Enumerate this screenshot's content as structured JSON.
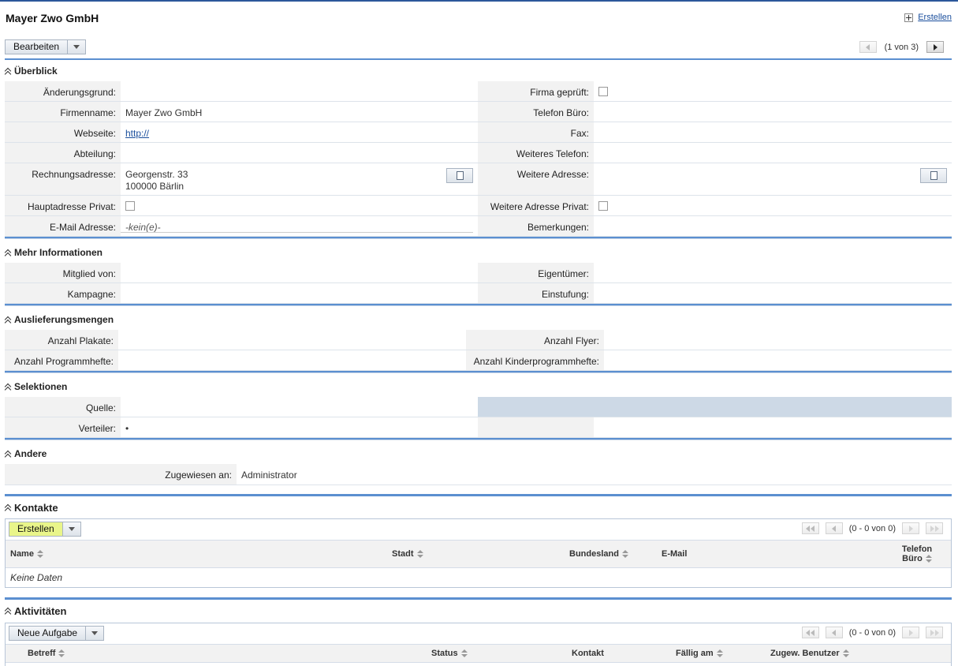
{
  "page": {
    "title": "Mayer Zwo GmbH",
    "create_link": "Erstellen"
  },
  "toolbar": {
    "edit_label": "Bearbeiten",
    "pager_text": "(1 von 3)"
  },
  "overview": {
    "title": "Überblick",
    "rows": [
      {
        "l1": "Änderungsgrund:",
        "v1": "",
        "l2": "Firma geprüft:",
        "v2": ""
      },
      {
        "l1": "Firmenname:",
        "v1": "Mayer Zwo GmbH",
        "l2": "Telefon Büro:",
        "v2": ""
      },
      {
        "l1": "Webseite:",
        "v1": "http://",
        "l2": "Fax:",
        "v2": ""
      },
      {
        "l1": "Abteilung:",
        "v1": "",
        "l2": "Weiteres Telefon:",
        "v2": ""
      },
      {
        "l1": "Rechnungsadresse:",
        "v1a": "Georgenstr. 33",
        "v1b": "100000 Bärlin",
        "l2": "Weitere Adresse:",
        "v2": ""
      },
      {
        "l1": "Hauptadresse Privat:",
        "v1": "",
        "l2": "Weitere Adresse Privat:",
        "v2": ""
      },
      {
        "l1": "E-Mail Adresse:",
        "v1": "-kein(e)-",
        "l2": "Bemerkungen:",
        "v2": ""
      }
    ]
  },
  "more": {
    "title": "Mehr Informationen",
    "rows": [
      {
        "l1": "Mitglied von:",
        "l2": "Eigentümer:"
      },
      {
        "l1": "Kampagne:",
        "l2": "Einstufung:"
      }
    ]
  },
  "delivery": {
    "title": "Auslieferungsmengen",
    "rows": [
      {
        "l1": "Anzahl Plakate:",
        "l2": "Anzahl Flyer:"
      },
      {
        "l1": "Anzahl Programmhefte:",
        "l2": "Anzahl Kinderprogrammhefte:"
      }
    ]
  },
  "selections": {
    "title": "Selektionen",
    "rows": [
      {
        "l1": "Quelle:",
        "v1": ""
      },
      {
        "l1": "Verteiler:",
        "v1": "•"
      }
    ]
  },
  "other": {
    "title": "Andere",
    "assigned_label": "Zugewiesen an:",
    "assigned_value": "Administrator"
  },
  "contacts": {
    "title": "Kontakte",
    "create_label": "Erstellen",
    "pager_text": "(0 - 0 von 0)",
    "columns": [
      "Name",
      "Stadt",
      "Bundesland",
      "E-Mail",
      "Telefon",
      "Büro"
    ],
    "empty_text": "Keine Daten"
  },
  "activities": {
    "title": "Aktivitäten",
    "create_label": "Neue Aufgabe",
    "pager_text": "(0 - 0 von 0)",
    "columns": [
      "Betreff",
      "Status",
      "Kontakt",
      "Fällig am",
      "Zugew. Benutzer"
    ]
  },
  "colors": {
    "accent": "#5b8fd0",
    "highlight": "#e9f58a",
    "selection_blue": "#cdd9e6"
  }
}
